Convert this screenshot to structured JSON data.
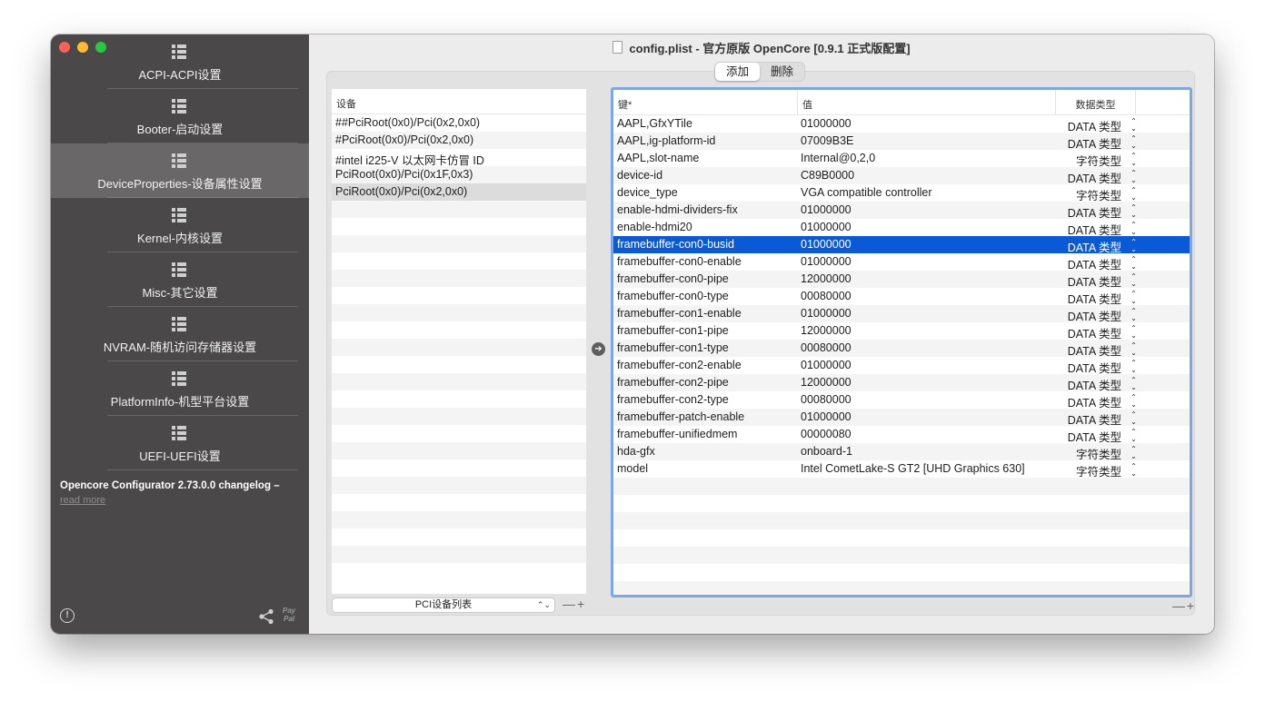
{
  "window": {
    "title": "config.plist - 官方原版 OpenCore [0.9.1 正式版配置]"
  },
  "sidebar": {
    "items": [
      {
        "label": "ACPI-ACPI设置",
        "active": false
      },
      {
        "label": "Booter-启动设置",
        "active": false
      },
      {
        "label": "DeviceProperties-设备属性设置",
        "active": true
      },
      {
        "label": "Kernel-内核设置",
        "active": false
      },
      {
        "label": "Misc-其它设置",
        "active": false
      },
      {
        "label": "NVRAM-随机访问存储器设置",
        "active": false
      },
      {
        "label": "PlatformInfo-机型平台设置",
        "active": false
      },
      {
        "label": "UEFI-UEFI设置",
        "active": false
      }
    ],
    "changelog_title": "Opencore Configurator 2.73.0.0 changelog –",
    "changelog_link": "read more",
    "info_glyph": "!",
    "paypal_text": "Pay Pal"
  },
  "toolbar": {
    "add_label": "添加",
    "delete_label": "删除"
  },
  "devices": {
    "header": "设备",
    "rows": [
      "##PciRoot(0x0)/Pci(0x2,0x0)",
      "#PciRoot(0x0)/Pci(0x2,0x0)",
      "#intel i225-V 以太网卡仿冒 ID",
      "PciRoot(0x0)/Pci(0x1F,0x3)",
      "PciRoot(0x0)/Pci(0x2,0x0)"
    ],
    "selected_index": 4,
    "selector_value": "PCI设备列表",
    "minus_plus": "—+"
  },
  "properties": {
    "headers": {
      "key": "键*",
      "value": "值",
      "type": "数据类型"
    },
    "rows": [
      {
        "key": "AAPL,GfxYTile",
        "value": "01000000",
        "type": "DATA 类型"
      },
      {
        "key": "AAPL,ig-platform-id",
        "value": "07009B3E",
        "type": "DATA 类型"
      },
      {
        "key": "AAPL,slot-name",
        "value": "Internal@0,2,0",
        "type": "字符类型"
      },
      {
        "key": "device-id",
        "value": "C89B0000",
        "type": "DATA 类型"
      },
      {
        "key": "device_type",
        "value": "VGA compatible controller",
        "type": "字符类型"
      },
      {
        "key": "enable-hdmi-dividers-fix",
        "value": "01000000",
        "type": "DATA 类型"
      },
      {
        "key": "enable-hdmi20",
        "value": "01000000",
        "type": "DATA 类型"
      },
      {
        "key": "framebuffer-con0-busid",
        "value": "01000000",
        "type": "DATA 类型"
      },
      {
        "key": "framebuffer-con0-enable",
        "value": "01000000",
        "type": "DATA 类型"
      },
      {
        "key": "framebuffer-con0-pipe",
        "value": "12000000",
        "type": "DATA 类型"
      },
      {
        "key": "framebuffer-con0-type",
        "value": "00080000",
        "type": "DATA 类型"
      },
      {
        "key": "framebuffer-con1-enable",
        "value": "01000000",
        "type": "DATA 类型"
      },
      {
        "key": "framebuffer-con1-pipe",
        "value": "12000000",
        "type": "DATA 类型"
      },
      {
        "key": "framebuffer-con1-type",
        "value": "00080000",
        "type": "DATA 类型"
      },
      {
        "key": "framebuffer-con2-enable",
        "value": "01000000",
        "type": "DATA 类型"
      },
      {
        "key": "framebuffer-con2-pipe",
        "value": "12000000",
        "type": "DATA 类型"
      },
      {
        "key": "framebuffer-con2-type",
        "value": "00080000",
        "type": "DATA 类型"
      },
      {
        "key": "framebuffer-patch-enable",
        "value": "01000000",
        "type": "DATA 类型"
      },
      {
        "key": "framebuffer-unifiedmem",
        "value": "00000080",
        "type": "DATA 类型"
      },
      {
        "key": "hda-gfx",
        "value": "onboard-1",
        "type": "字符类型"
      },
      {
        "key": "model",
        "value": "Intel CometLake-S GT2 [UHD Graphics 630]",
        "type": "字符类型"
      }
    ],
    "selected_index": 7,
    "minus_plus": "—+"
  },
  "colors": {
    "sidebar_bg": "#4a4849",
    "sidebar_active": "#696768",
    "selection_blue": "#0a5ad7",
    "focus_ring": "#7fa6e2"
  }
}
